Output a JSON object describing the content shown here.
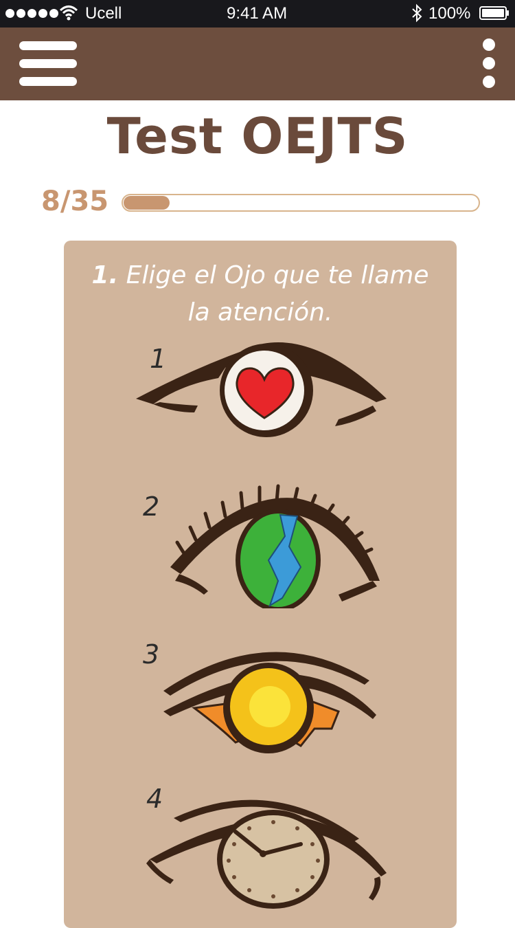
{
  "status_bar": {
    "carrier": "Ucell",
    "time": "9:41 AM",
    "battery": "100%",
    "icons": [
      "signal-icon",
      "wifi-icon",
      "bluetooth-icon",
      "battery-icon"
    ]
  },
  "app_bar": {
    "menu_icon": "hamburger-icon",
    "more_icon": "more-vertical-icon",
    "color": "#6d4e3e"
  },
  "page": {
    "title": "Test OEJTS"
  },
  "progress": {
    "label": "8/35",
    "current": 8,
    "total": 35,
    "percent": 13
  },
  "question": {
    "number": "1.",
    "text": "Elige el Ojo que te llame la atención.",
    "options": [
      {
        "label": "1",
        "icon": "heart-eye-icon"
      },
      {
        "label": "2",
        "icon": "earth-eye-icon"
      },
      {
        "label": "3",
        "icon": "sun-eye-icon"
      },
      {
        "label": "4",
        "icon": "clock-eye-icon"
      }
    ]
  },
  "colors": {
    "accent": "#c89670",
    "title": "#6a4a3b",
    "card": "#d1b59c",
    "status_bar": "#18181c"
  }
}
